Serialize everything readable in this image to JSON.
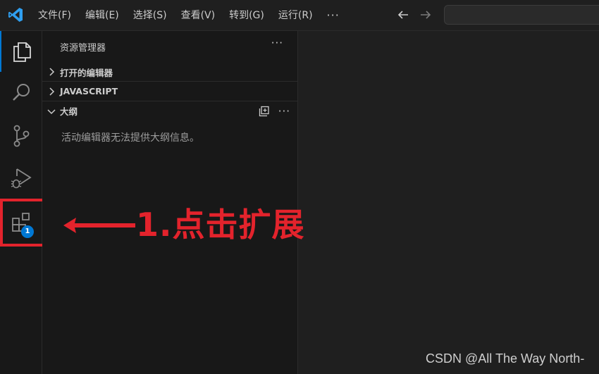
{
  "menu": {
    "items": [
      "文件(F)",
      "编辑(E)",
      "选择(S)",
      "查看(V)",
      "转到(G)",
      "运行(R)"
    ],
    "more": "···"
  },
  "activity": {
    "items": [
      {
        "name": "explorer",
        "active": true
      },
      {
        "name": "search",
        "active": false
      },
      {
        "name": "source-control",
        "active": false
      },
      {
        "name": "run-and-debug",
        "active": false
      },
      {
        "name": "extensions",
        "active": false,
        "badge": "1"
      }
    ]
  },
  "sidebar": {
    "title": "资源管理器",
    "more": "···",
    "sections": [
      {
        "label": "打开的编辑器",
        "expanded": false
      },
      {
        "label": "JAVASCRIPT",
        "expanded": false
      },
      {
        "label": "大纲",
        "expanded": true
      }
    ],
    "outline_more": "···",
    "outline_empty": "活动编辑器无法提供大纲信息。"
  },
  "annotation": {
    "text": "1.点击扩展",
    "color": "#e3232c"
  },
  "watermark": "CSDN @All The Way North-",
  "colors": {
    "accent": "#0078d4",
    "background": "#1f1f1f",
    "sidebar": "#181818"
  }
}
